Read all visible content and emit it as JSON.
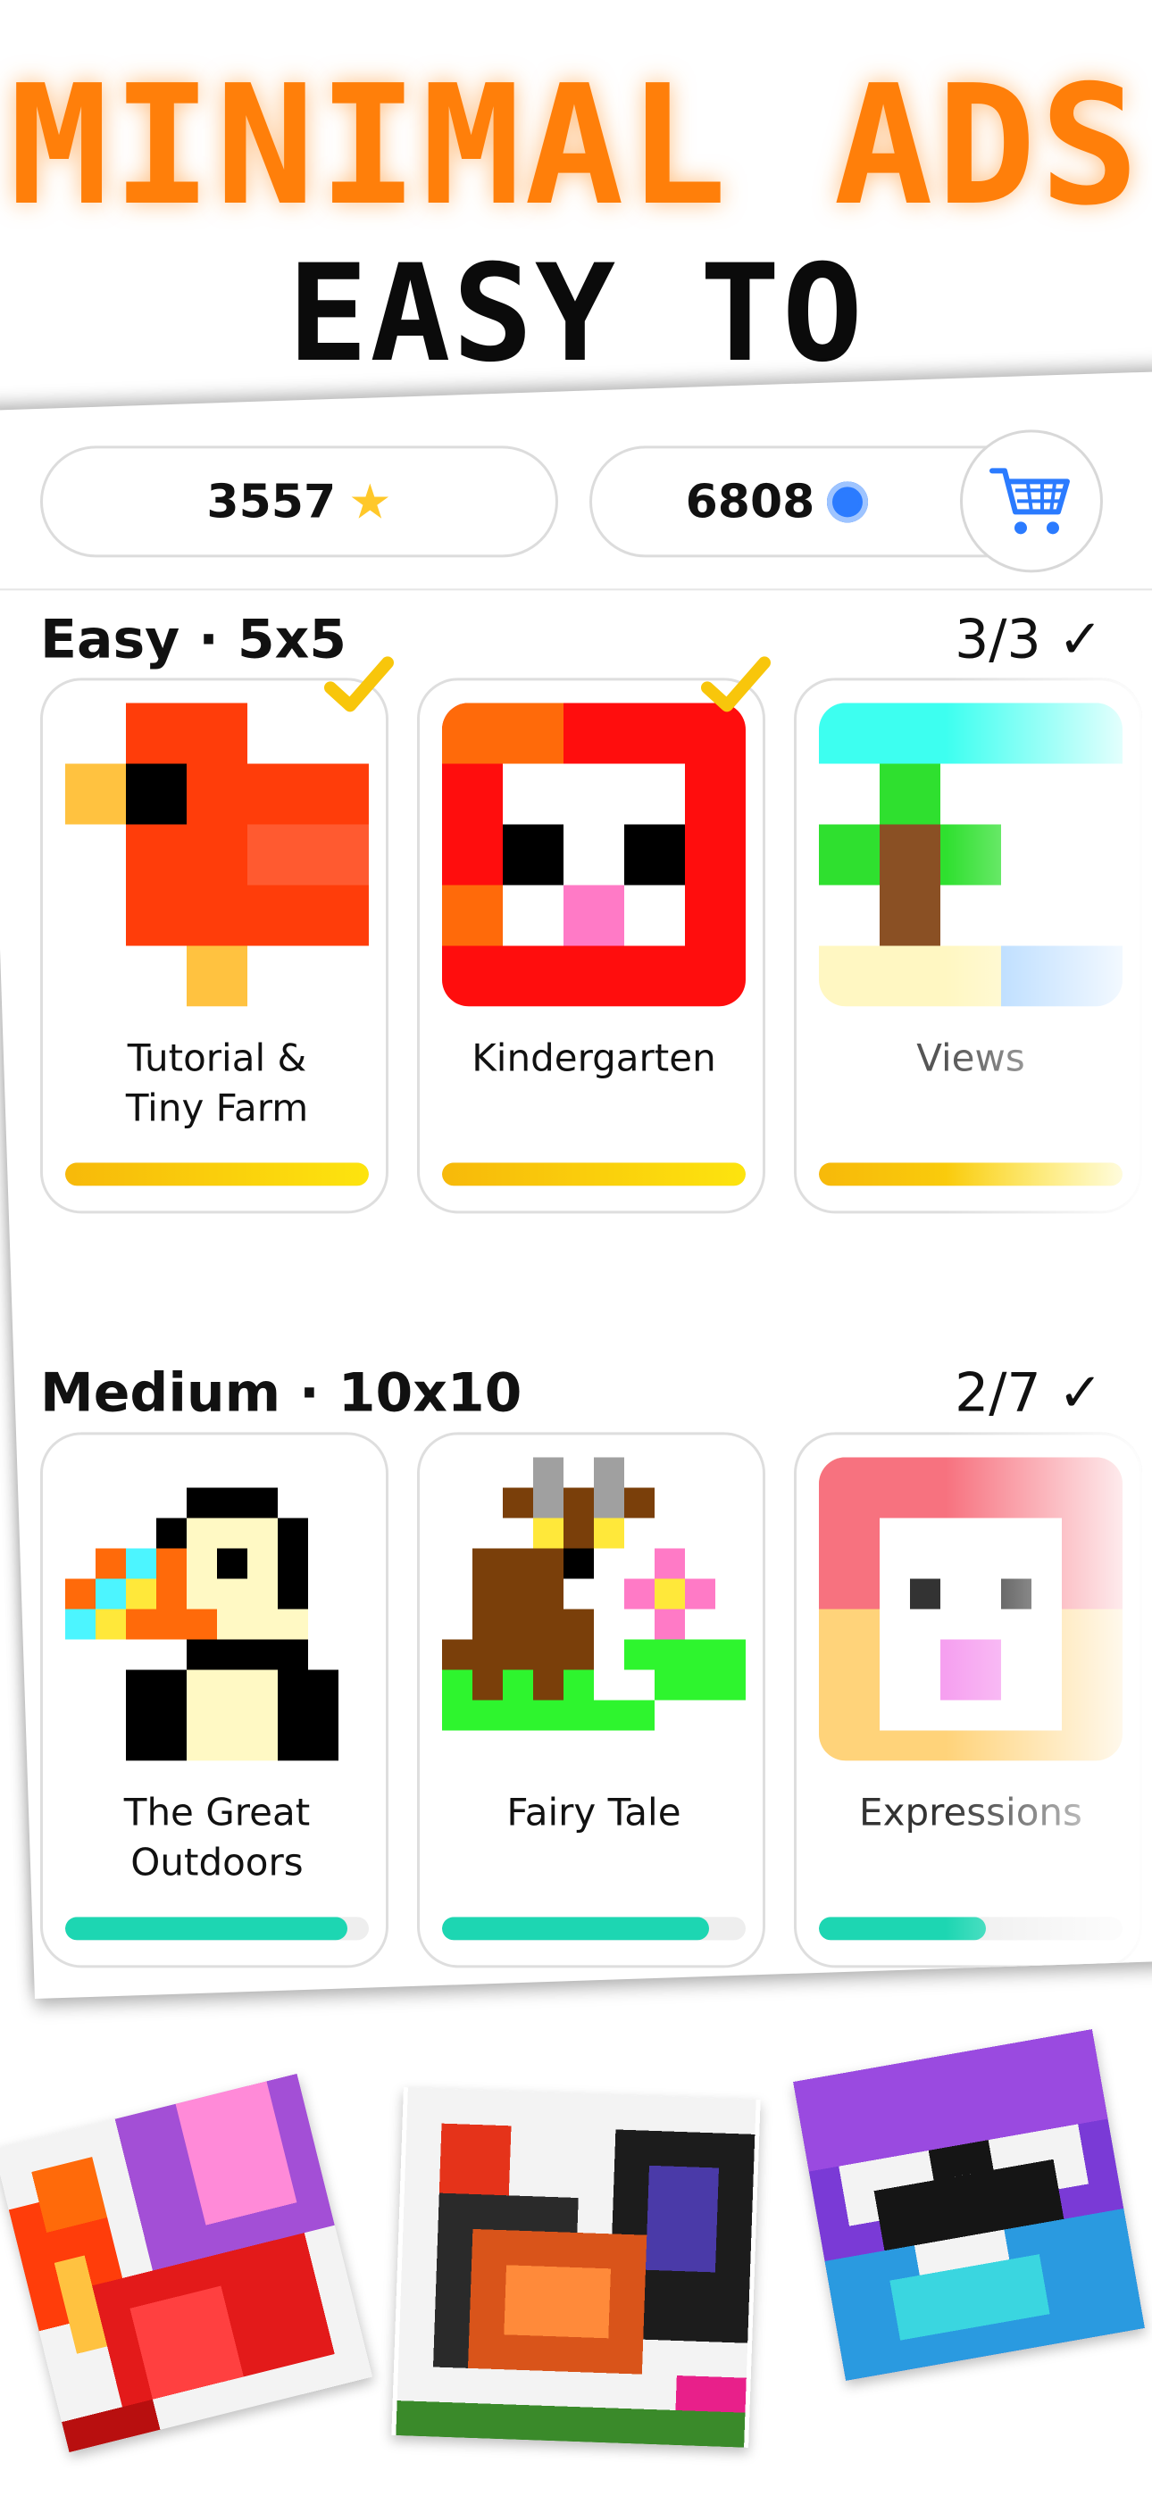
{
  "headline": {
    "line1": "MINIMAL ADS",
    "line2": "EASY TO EXTREME"
  },
  "wallet": {
    "stars": "3557",
    "coins": "6808"
  },
  "icons": {
    "star": "star-icon",
    "coin": "coin-icon",
    "cart": "shopping-cart-icon",
    "check": "checkmark-icon"
  },
  "colors": {
    "accent_orange": "#ff7f0a",
    "progress_yellow": "#f8c60b",
    "progress_teal": "#1dd6b2",
    "coin_blue": "#2b7bff"
  },
  "sections": [
    {
      "title": "Easy · 5x5",
      "count": "3/3 ✓",
      "packs": [
        {
          "name": "Tutorial & Tiny Farm",
          "line1": "Tutorial &",
          "line2": "Tiny Farm",
          "progress": 1.0,
          "completed": true
        },
        {
          "name": "Kindergarten",
          "line1": "Kindergarten",
          "line2": "",
          "progress": 1.0,
          "completed": true
        },
        {
          "name": "Views",
          "line1": "Views",
          "line2": "",
          "progress": 1.0,
          "completed": true
        }
      ]
    },
    {
      "title": "Medium · 10x10",
      "count": "2/7 ✓",
      "packs": [
        {
          "name": "The Great Outdoors",
          "line1": "The Great",
          "line2": "Outdoors",
          "progress": 0.93,
          "completed": false
        },
        {
          "name": "Fairy Tale",
          "line1": "Fairy Tale",
          "line2": "",
          "progress": 0.88,
          "completed": false
        },
        {
          "name": "Expressions",
          "line1": "Expressions",
          "line2": "",
          "progress": 0.55,
          "completed": false
        }
      ]
    }
  ]
}
